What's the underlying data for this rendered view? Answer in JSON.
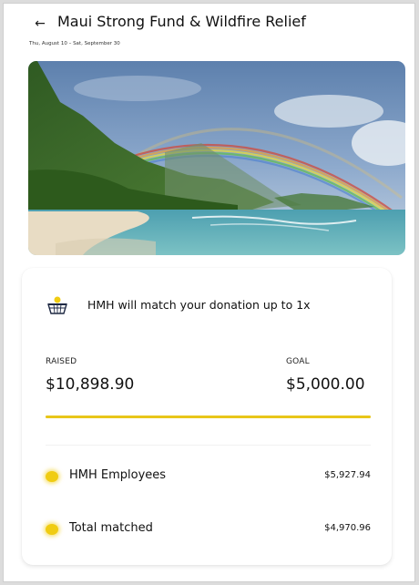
{
  "header": {
    "back_icon": "arrow-left-icon",
    "back_glyph": "←",
    "title": "Maui Strong Fund & Wildfire Relief",
    "date_range": "Thu, August 10 – Sat, September 30"
  },
  "hero": {
    "alt": "Rainbow over a tropical beach with green mountains",
    "colors": {
      "sky": "#6f8fb8",
      "sea": "#5fb0b8",
      "sand": "#e8dcc4",
      "mountain": "#3e6b2c"
    }
  },
  "match": {
    "icon": "basket-icon",
    "text": "HMH will match your donation up to 1x"
  },
  "totals": {
    "raised_label": "RAISED",
    "raised_value": "$10,898.90",
    "goal_label": "GOAL",
    "goal_value": "$5,000.00",
    "progress_fraction": 1.0
  },
  "breakdown": [
    {
      "label": "HMH Employees",
      "amount": "$5,927.94"
    },
    {
      "label": "Total matched",
      "amount": "$4,970.96"
    }
  ],
  "colors": {
    "accent": "#e8c619",
    "dot": "#f0cc12"
  }
}
